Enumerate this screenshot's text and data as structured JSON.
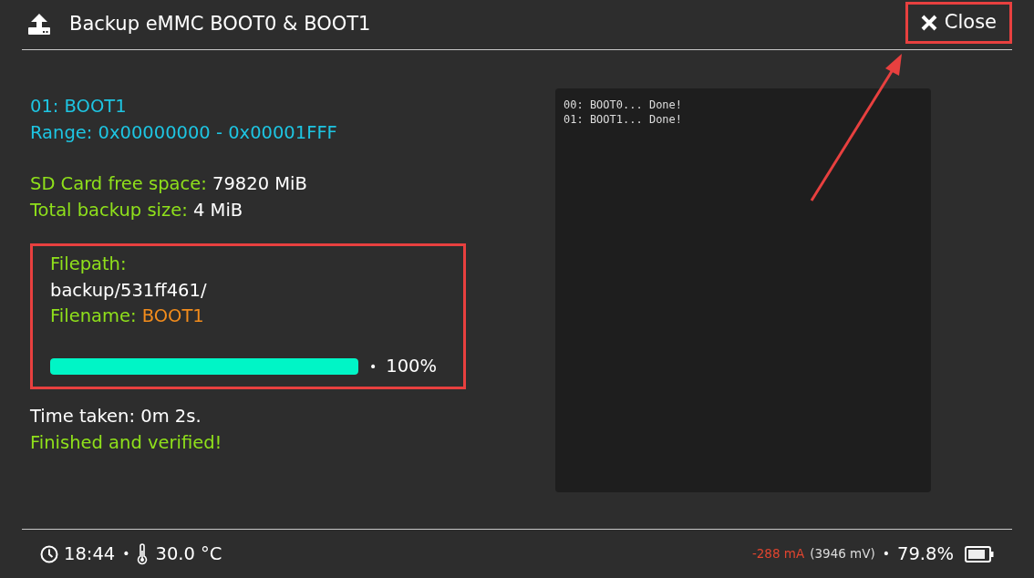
{
  "header": {
    "title": "Backup eMMC BOOT0 & BOOT1",
    "close_button": {
      "label": "Close",
      "highlighted": true,
      "callout_arrow": true
    }
  },
  "partition": {
    "name": "01: BOOT1",
    "range": "Range: 0x00000000 - 0x00001FFF"
  },
  "space": [
    {
      "label": "SD Card free space:",
      "value": "79820 MiB"
    },
    {
      "label": "Total backup size:",
      "value": "4 MiB"
    }
  ],
  "file_panel": {
    "highlighted": true,
    "filepath_label": "Filepath:",
    "filepath": "backup/531ff461/",
    "filename_label": "Filename:",
    "filename": "BOOT1",
    "progress": {
      "level": 1.0,
      "separator": "•",
      "reading": "100%"
    }
  },
  "result": {
    "time_taken": "Time taken: 0m 2s.",
    "status": "Finished and verified!"
  },
  "log": [
    "00: BOOT0... Done!",
    "01: BOOT1... Done!"
  ],
  "status_bar": {
    "time": "18:44",
    "separator_1": "•",
    "temperature": "30.0 °C",
    "current": "-288 mA",
    "voltage": "(3946 mV)",
    "separator_2": "•",
    "battery": "79.8%"
  }
}
